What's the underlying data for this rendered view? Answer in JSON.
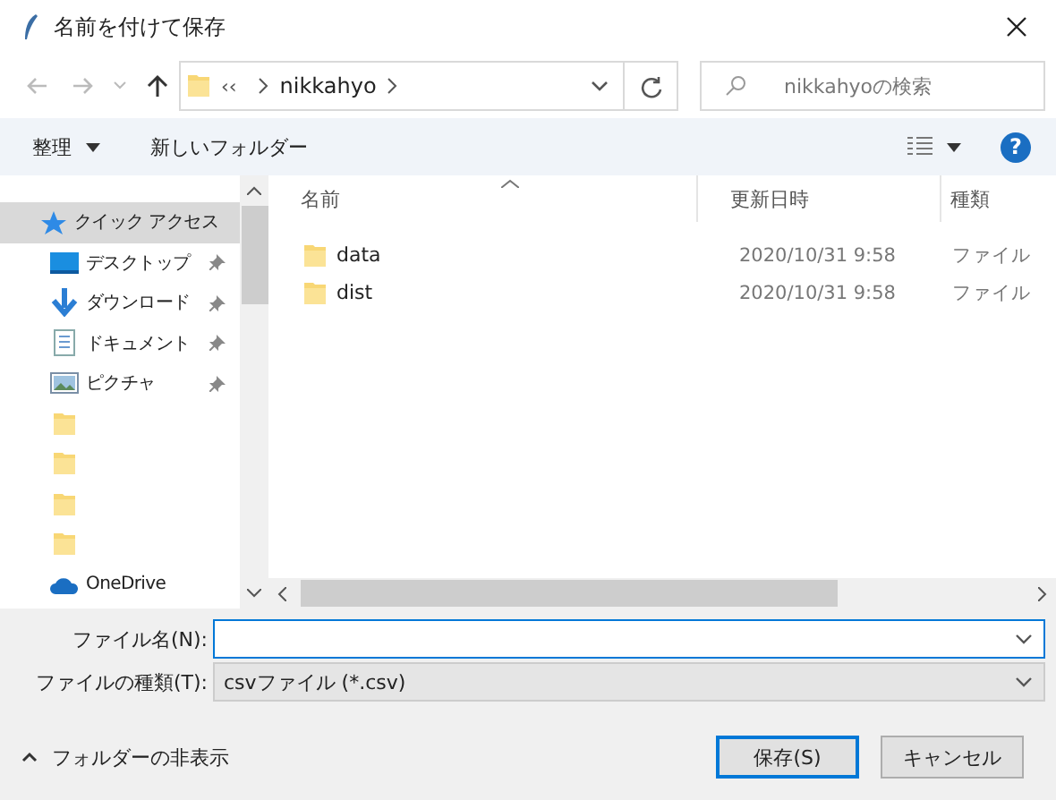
{
  "window": {
    "title": "名前を付けて保存"
  },
  "address": {
    "overflow": "‹‹",
    "crumbs": [
      "nikkahyo"
    ]
  },
  "search": {
    "placeholder": "nikkahyoの検索"
  },
  "toolbar": {
    "organize": "整理",
    "new_folder": "新しいフォルダー",
    "help": "?"
  },
  "sidebar": {
    "items": [
      {
        "kind": "quick",
        "label": "クイック アクセス",
        "selected": true,
        "pinned": false
      },
      {
        "kind": "desktop",
        "label": "デスクトップ",
        "selected": false,
        "pinned": true
      },
      {
        "kind": "downloads",
        "label": "ダウンロード",
        "selected": false,
        "pinned": true
      },
      {
        "kind": "documents",
        "label": "ドキュメント",
        "selected": false,
        "pinned": true
      },
      {
        "kind": "pictures",
        "label": "ピクチャ",
        "selected": false,
        "pinned": true
      },
      {
        "kind": "folder",
        "selected": false,
        "pinned": false
      },
      {
        "kind": "folder",
        "selected": false,
        "pinned": false
      },
      {
        "kind": "folder",
        "selected": false,
        "pinned": false
      },
      {
        "kind": "folder",
        "selected": false,
        "pinned": false
      },
      {
        "kind": "cloud",
        "label": "OneDrive",
        "selected": false,
        "pinned": false
      }
    ]
  },
  "table": {
    "columns": [
      "名前",
      "更新日時",
      "種類"
    ],
    "rows": [
      {
        "name": "data",
        "modified": "2020/10/31 9:58",
        "type": "ファイル"
      },
      {
        "name": "dist",
        "modified": "2020/10/31 9:58",
        "type": "ファイル"
      }
    ]
  },
  "form": {
    "filename_label": "ファイル名(N):",
    "type_label": "ファイルの種類(T):",
    "type_value": "csvファイル (*.csv)"
  },
  "footer": {
    "hide_folders": "フォルダーの非表示",
    "save": "保存(S)",
    "cancel": "キャンセル"
  }
}
